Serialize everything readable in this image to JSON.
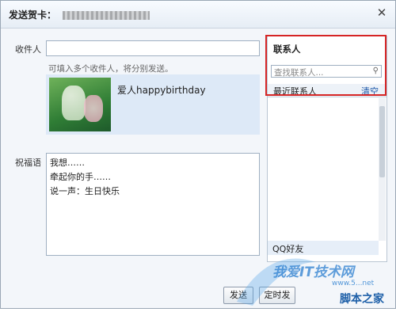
{
  "dialog": {
    "title": "发送贺卡：",
    "close_label": "✕"
  },
  "recipient": {
    "label": "收件人",
    "value": "",
    "hint": "可填入多个收件人，将分别发送。"
  },
  "card": {
    "name": "爱人happybirthday"
  },
  "message": {
    "label": "祝福语",
    "lines": [
      "我想……",
      "牵起你的手……",
      "说一声：生日快乐"
    ]
  },
  "contacts": {
    "header": "联系人",
    "search_placeholder": "查找联系人...",
    "recent_label": "最近联系人",
    "clear_label": "清空",
    "items": [
      "",
      "",
      "",
      "",
      "",
      "",
      "",
      "",
      "",
      ""
    ],
    "qq_friends_label": "QQ好友"
  },
  "footer": {
    "send_label": "发送",
    "timer_label": "定时发"
  },
  "watermark": {
    "brand": "我爱IT技术网",
    "site": "www.5...net",
    "sub": "脚本之家"
  },
  "colors": {
    "highlight": "#d62525",
    "link": "#1a56a8"
  }
}
